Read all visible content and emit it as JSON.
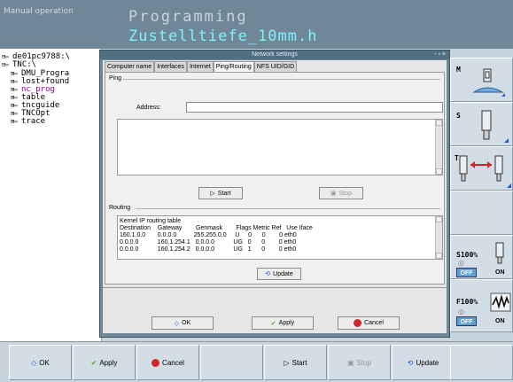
{
  "header": {
    "mode": "Manual operation",
    "title": "Programming",
    "file": "Zustelltiefe_10mm.h"
  },
  "tree": {
    "items": [
      {
        "label": "de01pc9788:\\",
        "highlight": false
      },
      {
        "label": "TNC:\\",
        "highlight": false
      },
      {
        "label": "DMU_Progra",
        "highlight": false
      },
      {
        "label": "lost+found",
        "highlight": false
      },
      {
        "label": "nc_prog",
        "highlight": true
      },
      {
        "label": "table",
        "highlight": false
      },
      {
        "label": "tncguide",
        "highlight": false
      },
      {
        "label": "TNCOpt",
        "highlight": false
      },
      {
        "label": "trace",
        "highlight": false
      }
    ]
  },
  "dialog": {
    "title": "Network settings",
    "window_controls": "- ▫ ×",
    "tabs": [
      {
        "label": "Computer name",
        "active": false
      },
      {
        "label": "Interfaces",
        "active": false
      },
      {
        "label": "Internet",
        "active": false
      },
      {
        "label": "Ping/Routing",
        "active": true
      },
      {
        "label": "NFS UID/GID",
        "active": false
      }
    ],
    "ping": {
      "group": "Ping",
      "address_label": "Address:",
      "address_value": "",
      "start": "Start",
      "stop": "Stop"
    },
    "routing": {
      "group": "Routing",
      "lines": [
        "Kernel IP routing table",
        "Destination    Gateway        Genmask        Flags Metric Ref   Use Iface",
        "160.1.0.0       0.0.0.0          255.255.0.0     U     0      0        0 eth0",
        "0.0.0.0           160.1.254.1   0.0.0.0           UG   0      0        0 eth0",
        "0.0.0.0           160.1.254.2   0.0.0.0           UG   1      0        0 eth0"
      ],
      "update": "Update"
    },
    "footer": {
      "ok": "OK",
      "apply": "Apply",
      "cancel": "Cancel"
    }
  },
  "softkeys_right": {
    "s100": "S100%",
    "f100": "F100%",
    "off": "OFF",
    "on": "ON",
    "m_label": "M",
    "s_label": "S",
    "t_label": "T"
  },
  "bottom_softkeys": {
    "ok": "OK",
    "apply": "Apply",
    "cancel": "Cancel",
    "start": "Start",
    "stop": "Stop",
    "update": "Update"
  },
  "colors": {
    "header_bg": "#6f8797",
    "file_cyan": "#7ff3ff",
    "accent_blue": "#1b57d6",
    "cancel_red": "#d0262a",
    "apply_green": "#5aa53a"
  }
}
